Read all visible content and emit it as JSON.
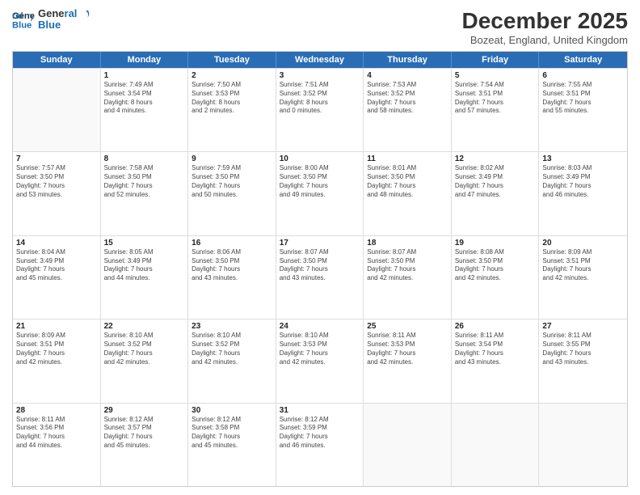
{
  "logo": {
    "line1": "General",
    "line2": "Blue"
  },
  "title": "December 2025",
  "subtitle": "Bozeat, England, United Kingdom",
  "days": [
    "Sunday",
    "Monday",
    "Tuesday",
    "Wednesday",
    "Thursday",
    "Friday",
    "Saturday"
  ],
  "weeks": [
    [
      {
        "day": "",
        "info": ""
      },
      {
        "day": "1",
        "info": "Sunrise: 7:49 AM\nSunset: 3:54 PM\nDaylight: 8 hours\nand 4 minutes."
      },
      {
        "day": "2",
        "info": "Sunrise: 7:50 AM\nSunset: 3:53 PM\nDaylight: 8 hours\nand 2 minutes."
      },
      {
        "day": "3",
        "info": "Sunrise: 7:51 AM\nSunset: 3:52 PM\nDaylight: 8 hours\nand 0 minutes."
      },
      {
        "day": "4",
        "info": "Sunrise: 7:53 AM\nSunset: 3:52 PM\nDaylight: 7 hours\nand 58 minutes."
      },
      {
        "day": "5",
        "info": "Sunrise: 7:54 AM\nSunset: 3:51 PM\nDaylight: 7 hours\nand 57 minutes."
      },
      {
        "day": "6",
        "info": "Sunrise: 7:55 AM\nSunset: 3:51 PM\nDaylight: 7 hours\nand 55 minutes."
      }
    ],
    [
      {
        "day": "7",
        "info": "Sunrise: 7:57 AM\nSunset: 3:50 PM\nDaylight: 7 hours\nand 53 minutes."
      },
      {
        "day": "8",
        "info": "Sunrise: 7:58 AM\nSunset: 3:50 PM\nDaylight: 7 hours\nand 52 minutes."
      },
      {
        "day": "9",
        "info": "Sunrise: 7:59 AM\nSunset: 3:50 PM\nDaylight: 7 hours\nand 50 minutes."
      },
      {
        "day": "10",
        "info": "Sunrise: 8:00 AM\nSunset: 3:50 PM\nDaylight: 7 hours\nand 49 minutes."
      },
      {
        "day": "11",
        "info": "Sunrise: 8:01 AM\nSunset: 3:50 PM\nDaylight: 7 hours\nand 48 minutes."
      },
      {
        "day": "12",
        "info": "Sunrise: 8:02 AM\nSunset: 3:49 PM\nDaylight: 7 hours\nand 47 minutes."
      },
      {
        "day": "13",
        "info": "Sunrise: 8:03 AM\nSunset: 3:49 PM\nDaylight: 7 hours\nand 46 minutes."
      }
    ],
    [
      {
        "day": "14",
        "info": "Sunrise: 8:04 AM\nSunset: 3:49 PM\nDaylight: 7 hours\nand 45 minutes."
      },
      {
        "day": "15",
        "info": "Sunrise: 8:05 AM\nSunset: 3:49 PM\nDaylight: 7 hours\nand 44 minutes."
      },
      {
        "day": "16",
        "info": "Sunrise: 8:06 AM\nSunset: 3:50 PM\nDaylight: 7 hours\nand 43 minutes."
      },
      {
        "day": "17",
        "info": "Sunrise: 8:07 AM\nSunset: 3:50 PM\nDaylight: 7 hours\nand 43 minutes."
      },
      {
        "day": "18",
        "info": "Sunrise: 8:07 AM\nSunset: 3:50 PM\nDaylight: 7 hours\nand 42 minutes."
      },
      {
        "day": "19",
        "info": "Sunrise: 8:08 AM\nSunset: 3:50 PM\nDaylight: 7 hours\nand 42 minutes."
      },
      {
        "day": "20",
        "info": "Sunrise: 8:09 AM\nSunset: 3:51 PM\nDaylight: 7 hours\nand 42 minutes."
      }
    ],
    [
      {
        "day": "21",
        "info": "Sunrise: 8:09 AM\nSunset: 3:51 PM\nDaylight: 7 hours\nand 42 minutes."
      },
      {
        "day": "22",
        "info": "Sunrise: 8:10 AM\nSunset: 3:52 PM\nDaylight: 7 hours\nand 42 minutes."
      },
      {
        "day": "23",
        "info": "Sunrise: 8:10 AM\nSunset: 3:52 PM\nDaylight: 7 hours\nand 42 minutes."
      },
      {
        "day": "24",
        "info": "Sunrise: 8:10 AM\nSunset: 3:53 PM\nDaylight: 7 hours\nand 42 minutes."
      },
      {
        "day": "25",
        "info": "Sunrise: 8:11 AM\nSunset: 3:53 PM\nDaylight: 7 hours\nand 42 minutes."
      },
      {
        "day": "26",
        "info": "Sunrise: 8:11 AM\nSunset: 3:54 PM\nDaylight: 7 hours\nand 43 minutes."
      },
      {
        "day": "27",
        "info": "Sunrise: 8:11 AM\nSunset: 3:55 PM\nDaylight: 7 hours\nand 43 minutes."
      }
    ],
    [
      {
        "day": "28",
        "info": "Sunrise: 8:11 AM\nSunset: 3:56 PM\nDaylight: 7 hours\nand 44 minutes."
      },
      {
        "day": "29",
        "info": "Sunrise: 8:12 AM\nSunset: 3:57 PM\nDaylight: 7 hours\nand 45 minutes."
      },
      {
        "day": "30",
        "info": "Sunrise: 8:12 AM\nSunset: 3:58 PM\nDaylight: 7 hours\nand 45 minutes."
      },
      {
        "day": "31",
        "info": "Sunrise: 8:12 AM\nSunset: 3:59 PM\nDaylight: 7 hours\nand 46 minutes."
      },
      {
        "day": "",
        "info": ""
      },
      {
        "day": "",
        "info": ""
      },
      {
        "day": "",
        "info": ""
      }
    ]
  ]
}
